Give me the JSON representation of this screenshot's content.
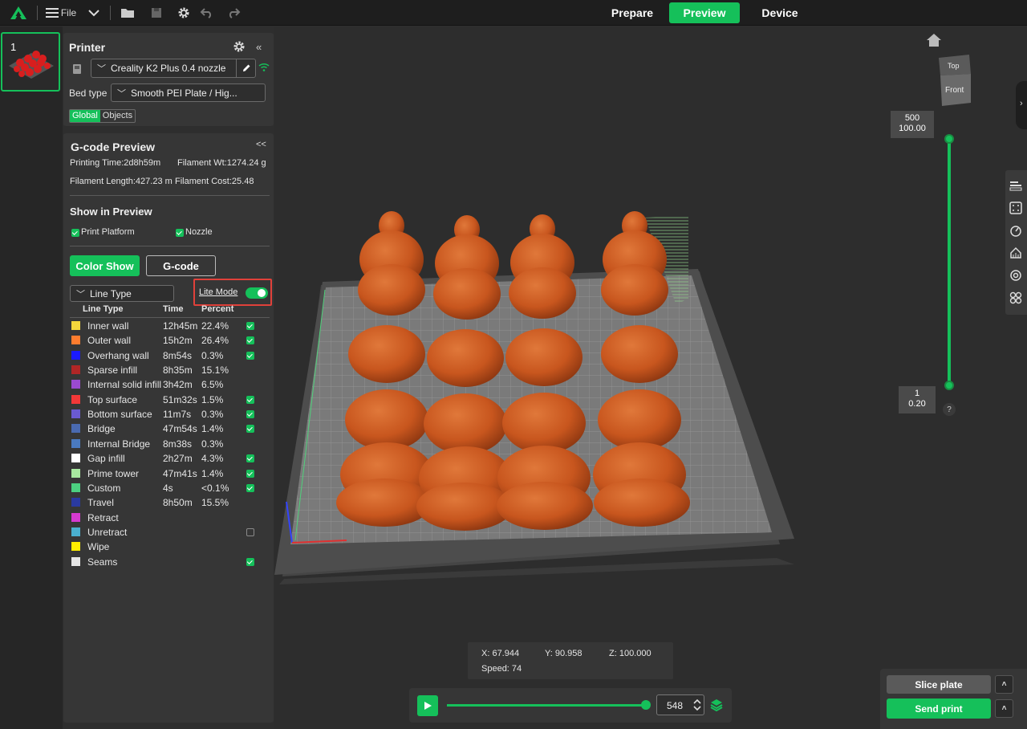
{
  "topbar": {
    "file_label": "File",
    "tabs": [
      {
        "label": "Prepare",
        "active": false
      },
      {
        "label": "Preview",
        "active": true
      },
      {
        "label": "Device",
        "active": false
      }
    ]
  },
  "plate": {
    "number": "1"
  },
  "printer": {
    "title": "Printer",
    "name": "Creality K2 Plus 0.4 nozzle",
    "bed_label": "Bed type",
    "bed_value": "Smooth PEI Plate / Hig...",
    "mode_global": "Global",
    "mode_objects": "Objects"
  },
  "gcode": {
    "title": "G-code Preview",
    "collapse": "<<",
    "printing_time": "Printing Time:2d8h59m",
    "filament_wt": "Filament Wt:1274.24 g",
    "filament_length": "Filament Length:427.23 m",
    "filament_cost": "Filament Cost:25.48",
    "show_title": "Show in Preview",
    "print_platform": "Print Platform",
    "nozzle": "Nozzle",
    "color_show": "Color Show",
    "gcode_btn": "G-code",
    "line_type_select": "Line Type",
    "lite_mode": "Lite Mode",
    "headers": [
      "Line Type",
      "Time",
      "Percent"
    ],
    "rows": [
      {
        "name": "Inner wall",
        "time": "12h45m",
        "pct": "22.4%",
        "color": "#f5d63c",
        "check": "on"
      },
      {
        "name": "Outer wall",
        "time": "15h2m",
        "pct": "26.4%",
        "color": "#ff7d2e",
        "check": "on"
      },
      {
        "name": "Overhang wall",
        "time": "8m54s",
        "pct": "0.3%",
        "color": "#1a1aff",
        "check": "on"
      },
      {
        "name": "Sparse infill",
        "time": "8h35m",
        "pct": "15.1%",
        "color": "#b02626",
        "check": "none"
      },
      {
        "name": "Internal solid infill",
        "time": "3h42m",
        "pct": "6.5%",
        "color": "#9b4ad0",
        "check": "none"
      },
      {
        "name": "Top surface",
        "time": "51m32s",
        "pct": "1.5%",
        "color": "#f23838",
        "check": "on"
      },
      {
        "name": "Bottom surface",
        "time": "11m7s",
        "pct": "0.3%",
        "color": "#6a5ad0",
        "check": "on"
      },
      {
        "name": "Bridge",
        "time": "47m54s",
        "pct": "1.4%",
        "color": "#4a6ab0",
        "check": "on"
      },
      {
        "name": "Internal Bridge",
        "time": "8m38s",
        "pct": "0.3%",
        "color": "#4a7ac0",
        "check": "none"
      },
      {
        "name": "Gap infill",
        "time": "2h27m",
        "pct": "4.3%",
        "color": "#ffffff",
        "check": "on"
      },
      {
        "name": "Prime tower",
        "time": "47m41s",
        "pct": "1.4%",
        "color": "#a8e8a0",
        "check": "on"
      },
      {
        "name": "Custom",
        "time": "4s",
        "pct": "<0.1%",
        "color": "#4cd080",
        "check": "on"
      },
      {
        "name": "Travel",
        "time": "8h50m",
        "pct": "15.5%",
        "color": "#2a3aa0",
        "check": "none"
      },
      {
        "name": "Retract",
        "time": "",
        "pct": "",
        "color": "#d63ad0",
        "check": "none"
      },
      {
        "name": "Unretract",
        "time": "",
        "pct": "",
        "color": "#4ab0d0",
        "check": "off"
      },
      {
        "name": "Wipe",
        "time": "",
        "pct": "",
        "color": "#ffee00",
        "check": "none"
      },
      {
        "name": "Seams",
        "time": "",
        "pct": "",
        "color": "#e6e6e6",
        "check": "on"
      }
    ]
  },
  "viewcube": {
    "top": "Top",
    "front": "Front"
  },
  "layer_slider": {
    "top_layer": "500",
    "top_height": "100.00",
    "bottom_layer": "1",
    "bottom_height": "0.20",
    "help": "?"
  },
  "coords": {
    "x": "X: 67.944",
    "y": "Y: 90.958",
    "z": "Z: 100.000",
    "speed": "Speed: 74"
  },
  "player": {
    "value": "548"
  },
  "actions": {
    "slice": "Slice plate",
    "send": "Send print"
  },
  "colors": {
    "accent": "#15c05a",
    "model": "#c8561e",
    "highlight_box": "#e0413a"
  }
}
